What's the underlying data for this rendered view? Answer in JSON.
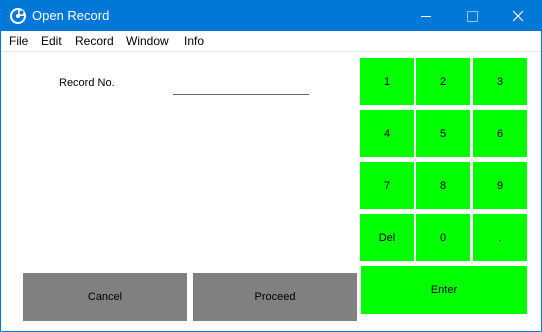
{
  "window": {
    "title": "Open Record",
    "icon": "app-logo-icon",
    "controls": [
      "minimize-icon",
      "maximize-icon",
      "close-icon"
    ]
  },
  "menu": {
    "items": [
      "File",
      "Edit",
      "Record",
      "Window",
      "Info"
    ]
  },
  "form": {
    "record_no_label": "Record No.",
    "record_no_value": ""
  },
  "keypad": {
    "keys": [
      "1",
      "2",
      "3",
      "4",
      "5",
      "6",
      "7",
      "8",
      "9",
      "Del",
      "0",
      "."
    ],
    "enter_label": "Enter"
  },
  "actions": {
    "cancel_label": "Cancel",
    "proceed_label": "Proceed"
  },
  "colors": {
    "titlebar": "#0078d7",
    "keypad": "#00ff00",
    "action_buttons": "#808080"
  }
}
